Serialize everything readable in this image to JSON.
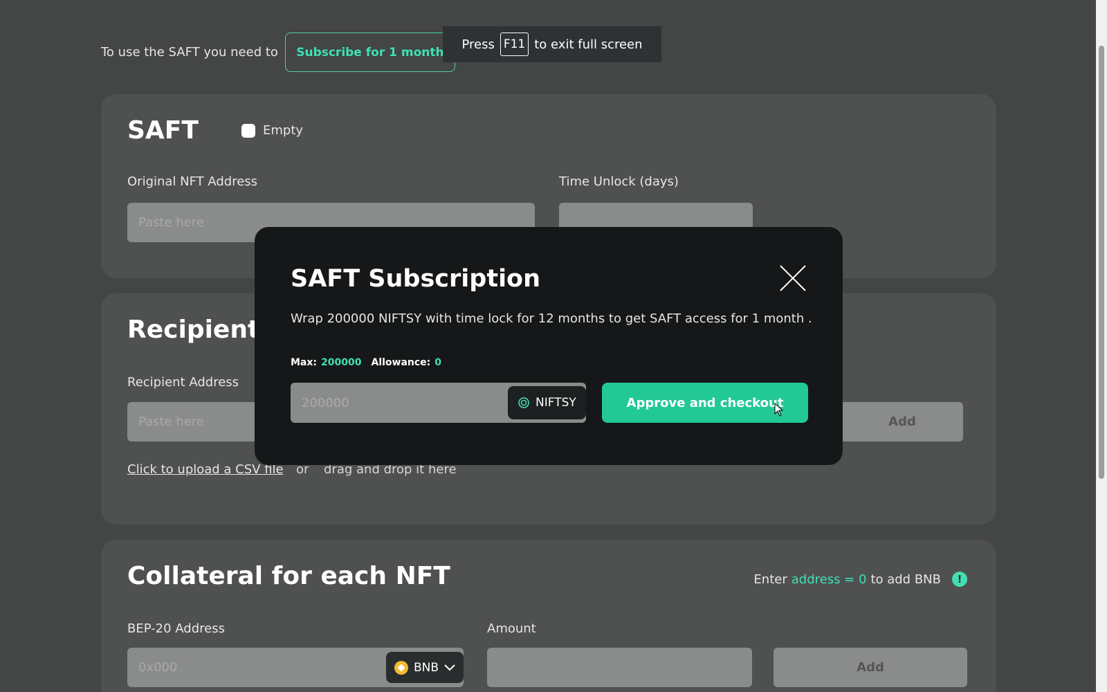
{
  "top": {
    "prompt": "To use the SAFT you need to",
    "subscribe_label": "Subscribe for 1 month"
  },
  "fullscreen_toast": {
    "press": "Press",
    "key": "F11",
    "suffix": "to exit full screen"
  },
  "saft": {
    "title": "SAFT",
    "empty_label": "Empty",
    "nft_address_label": "Original NFT Address",
    "nft_address_placeholder": "Paste here",
    "time_unlock_label": "Time Unlock (days)"
  },
  "recipients": {
    "title": "Recipients",
    "recipient_address_label": "Recipient Address",
    "recipient_placeholder": "Paste here",
    "add_label": "Add",
    "upload_link": "Click to upload a CSV file",
    "or": "or",
    "drag_text": "drag and drop it here"
  },
  "collateral": {
    "title": "Collateral for each NFT",
    "hint_prefix": "Enter",
    "hint_accent": "address = 0",
    "hint_suffix": "to add BNB",
    "bep20_label": "BEP-20 Address",
    "bep20_placeholder": "0x000",
    "token": "BNB",
    "amount_label": "Amount",
    "add_label": "Add"
  },
  "modal": {
    "title": "SAFT Subscription",
    "description": "Wrap 200000 NIFTSY with time lock for 12 months to get SAFT access for 1 month .",
    "max_label": "Max:",
    "max_value": "200000",
    "allowance_label": "Allowance:",
    "allowance_value": "0",
    "amount_placeholder": "200000",
    "token": "NIFTSY",
    "cta_label": "Approve and checkout"
  },
  "colors": {
    "accent": "#41e0b4",
    "cta": "#22c995",
    "background": "#444545",
    "card": "#4f5050",
    "modal": "#151718"
  },
  "icons": [
    "close-icon",
    "niftsy-icon",
    "bnb-icon",
    "chevron-down-icon",
    "info-icon",
    "cursor-icon"
  ]
}
